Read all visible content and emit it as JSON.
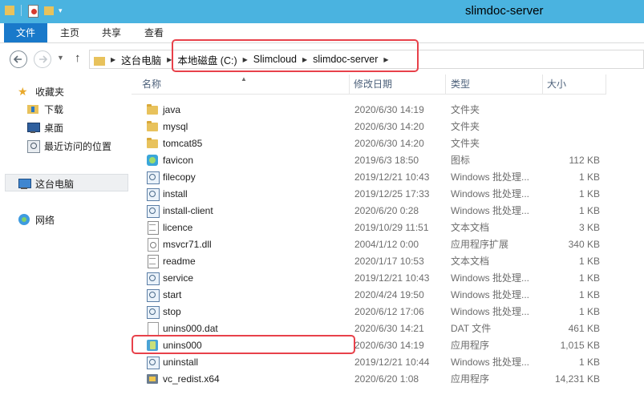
{
  "window": {
    "title": "slimdoc-server"
  },
  "ribbon": {
    "tabs": [
      {
        "label": "文件"
      },
      {
        "label": "主页"
      },
      {
        "label": "共享"
      },
      {
        "label": "查看"
      }
    ]
  },
  "address": {
    "crumbs": [
      "这台电脑",
      "本地磁盘 (C:)",
      "Slimcloud",
      "slimdoc-server"
    ]
  },
  "navpane": {
    "favorites_label": "收藏夹",
    "favorites": [
      {
        "label": "下载",
        "icon": "download-folder-icon"
      },
      {
        "label": "桌面",
        "icon": "desktop-icon"
      },
      {
        "label": "最近访问的位置",
        "icon": "recent-places-icon"
      }
    ],
    "this_pc_label": "这台电脑",
    "network_label": "网络"
  },
  "columns": {
    "name": "名称",
    "date": "修改日期",
    "type": "类型",
    "size": "大小"
  },
  "files": [
    {
      "name": "java",
      "date": "2020/6/30 14:19",
      "type": "文件夹",
      "size": "",
      "icon": "folder"
    },
    {
      "name": "mysql",
      "date": "2020/6/30 14:20",
      "type": "文件夹",
      "size": "",
      "icon": "folder"
    },
    {
      "name": "tomcat85",
      "date": "2020/6/30 14:20",
      "type": "文件夹",
      "size": "",
      "icon": "folder"
    },
    {
      "name": "favicon",
      "date": "2019/6/3 18:50",
      "type": "图标",
      "size": "112 KB",
      "icon": "ico"
    },
    {
      "name": "filecopy",
      "date": "2019/12/21 10:43",
      "type": "Windows 批处理...",
      "size": "1 KB",
      "icon": "bat"
    },
    {
      "name": "install",
      "date": "2019/12/25 17:33",
      "type": "Windows 批处理...",
      "size": "1 KB",
      "icon": "bat"
    },
    {
      "name": "install-client",
      "date": "2020/6/20 0:28",
      "type": "Windows 批处理...",
      "size": "1 KB",
      "icon": "bat"
    },
    {
      "name": "licence",
      "date": "2019/10/29 11:51",
      "type": "文本文档",
      "size": "3 KB",
      "icon": "txt"
    },
    {
      "name": "msvcr71.dll",
      "date": "2004/1/12 0:00",
      "type": "应用程序扩展",
      "size": "340 KB",
      "icon": "dll"
    },
    {
      "name": "readme",
      "date": "2020/1/17 10:53",
      "type": "文本文档",
      "size": "1 KB",
      "icon": "txt"
    },
    {
      "name": "service",
      "date": "2019/12/21 10:43",
      "type": "Windows 批处理...",
      "size": "1 KB",
      "icon": "bat"
    },
    {
      "name": "start",
      "date": "2020/4/24 19:50",
      "type": "Windows 批处理...",
      "size": "1 KB",
      "icon": "bat"
    },
    {
      "name": "stop",
      "date": "2020/6/12 17:06",
      "type": "Windows 批处理...",
      "size": "1 KB",
      "icon": "bat"
    },
    {
      "name": "unins000.dat",
      "date": "2020/6/30 14:21",
      "type": "DAT 文件",
      "size": "461 KB",
      "icon": "file"
    },
    {
      "name": "unins000",
      "date": "2020/6/30 14:19",
      "type": "应用程序",
      "size": "1,015 KB",
      "icon": "exe"
    },
    {
      "name": "uninstall",
      "date": "2019/12/21 10:44",
      "type": "Windows 批处理...",
      "size": "1 KB",
      "icon": "bat"
    },
    {
      "name": "vc_redist.x64",
      "date": "2020/6/20 1:08",
      "type": "应用程序",
      "size": "14,231 KB",
      "icon": "pkg"
    }
  ],
  "colors": {
    "titlebar": "#4ab3e0",
    "file_tab": "#1979ca",
    "highlight": "#e8414a"
  }
}
